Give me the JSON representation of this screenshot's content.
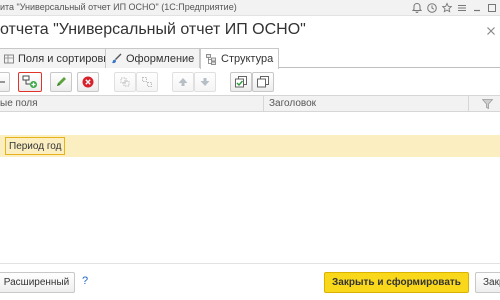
{
  "window": {
    "title": "ита \"Универсальный отчет ИП ОСНО\" (1С:Предприятие)"
  },
  "form": {
    "title": "отчета \"Универсальный отчет ИП ОСНО\""
  },
  "tabs": [
    {
      "label": "Поля и сортировки",
      "active": false
    },
    {
      "label": "Оформление",
      "active": false
    },
    {
      "label": "Структура",
      "active": true
    }
  ],
  "table": {
    "columns": [
      "ые поля",
      "Заголовок"
    ],
    "rows": [
      {
        "field": "Период год"
      }
    ]
  },
  "footer": {
    "mode_button": "Расширенный",
    "help": "?",
    "primary_button": "Закрыть и сформировать",
    "close_button": "Закр"
  },
  "colors": {
    "accent_yellow": "#f9d81b",
    "selected_row": "#fbefc1",
    "highlight_border": "#e0342a"
  }
}
